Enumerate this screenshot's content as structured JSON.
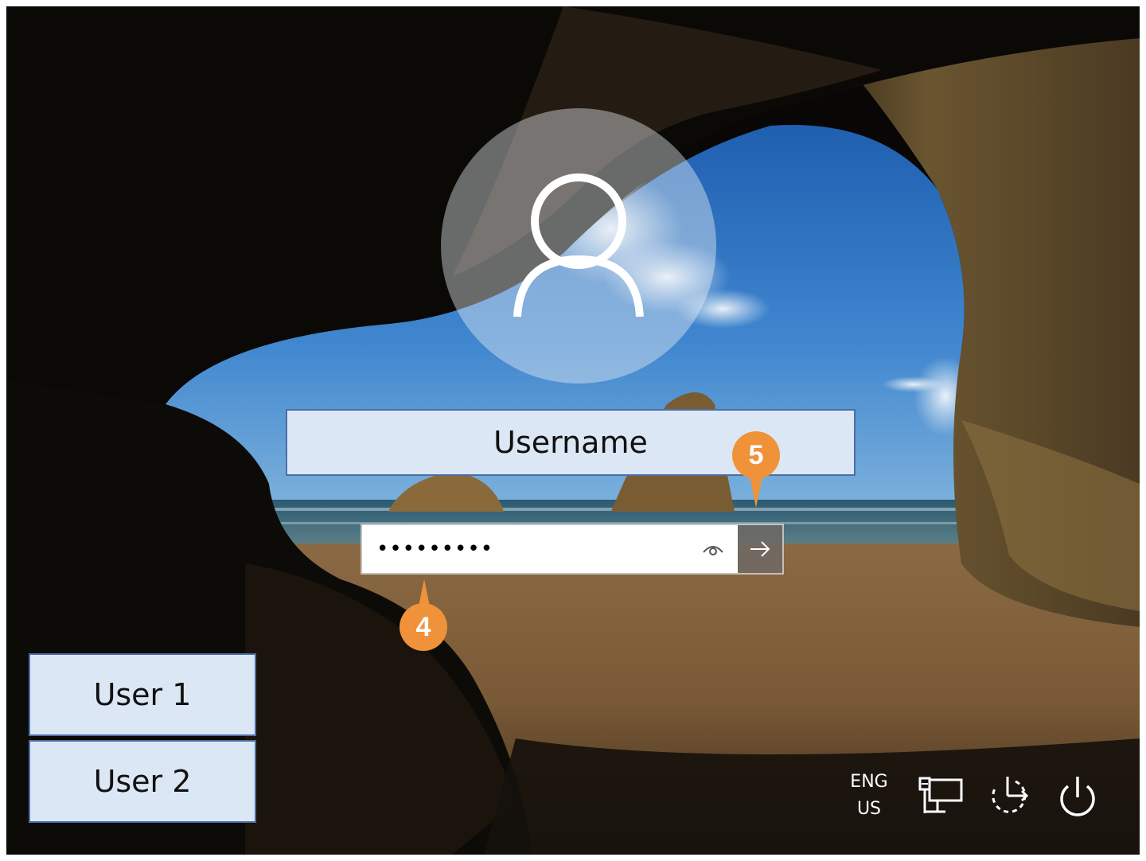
{
  "login": {
    "username": "Username",
    "password_masked": "•••••••••"
  },
  "callouts": {
    "password_step": "4",
    "submit_step": "5"
  },
  "users": [
    {
      "label": "User 1"
    },
    {
      "label": "User 2"
    }
  ],
  "tray": {
    "lang_line1": "ENG",
    "lang_line2": "US"
  },
  "icons": {
    "avatar": "user-silhouette-icon",
    "reveal": "eye-icon",
    "submit": "arrow-right-icon",
    "network": "network-icon",
    "ease_of_access": "ease-of-access-icon",
    "power": "power-icon"
  },
  "colors": {
    "callout": "#f0923a",
    "label_box_fill": "#dce7f5",
    "label_box_border": "#4a6fa5"
  }
}
